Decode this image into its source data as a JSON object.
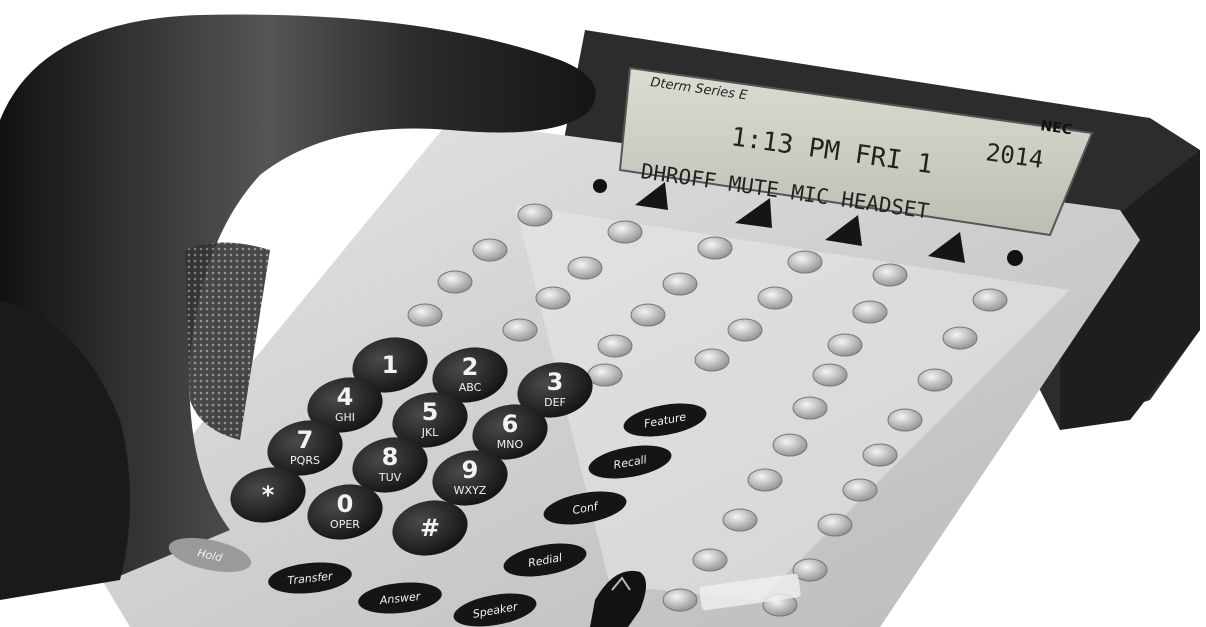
{
  "phone": {
    "brand": "NEC",
    "series": "Dterm Series E",
    "display": {
      "line1": "1:13  PM  FRI  1",
      "year": "2014",
      "line2": "DHROFF MUTE MIC HEADSET"
    },
    "keypad": [
      {
        "num": "1",
        "letters": ""
      },
      {
        "num": "2",
        "letters": "ABC"
      },
      {
        "num": "3",
        "letters": "DEF"
      },
      {
        "num": "4",
        "letters": "GHI"
      },
      {
        "num": "5",
        "letters": "JKL"
      },
      {
        "num": "6",
        "letters": "MNO"
      },
      {
        "num": "7",
        "letters": "PQRS"
      },
      {
        "num": "8",
        "letters": "TUV"
      },
      {
        "num": "9",
        "letters": "WXYZ"
      },
      {
        "num": "*",
        "letters": ""
      },
      {
        "num": "0",
        "letters": "OPER"
      },
      {
        "num": "#",
        "letters": ""
      }
    ],
    "function_keys": {
      "feature": "Feature",
      "recall": "Recall",
      "conf": "Conf",
      "redial": "Redial",
      "hold": "Hold",
      "transfer": "Transfer",
      "answer": "Answer",
      "speaker": "Speaker"
    },
    "colors": {
      "body": "#d6d6d6",
      "handset": "#2a2a2a",
      "display_bg": "#cfcfc4",
      "keys": "#1c1c1c"
    }
  }
}
